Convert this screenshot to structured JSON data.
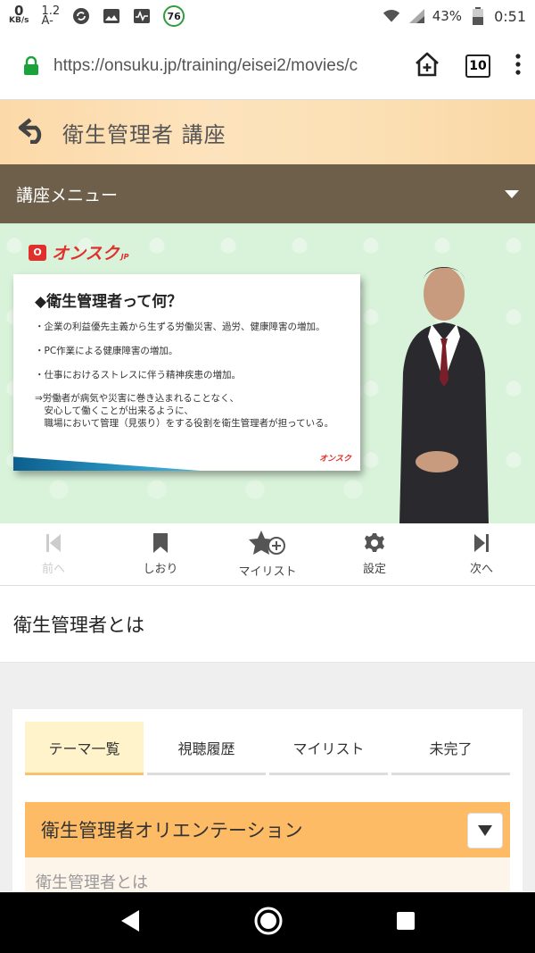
{
  "status_bar": {
    "net_speed_value": "0",
    "net_speed_unit": "KB/s",
    "text_size_top": "1.2",
    "text_size_bottom": "A-",
    "notification_badge": "76",
    "battery_percent": "43%",
    "time": "0:51"
  },
  "browser": {
    "url": "https://onsuku.jp/training/eisei2/movies/c",
    "tab_count": "10"
  },
  "course": {
    "title": "衛生管理者 講座"
  },
  "menu": {
    "label": "講座メニュー"
  },
  "video": {
    "brand": "オンスク",
    "brand_suffix": "JP",
    "slide_title": "◆衛生管理者って何？",
    "slide_lines": [
      "・企業の利益優先主義から生ずる労働災害、過労、健康障害の増加。",
      "・PC作業による健康障害の増加。",
      "・仕事におけるストレスに伴う精神疾患の増加。"
    ],
    "slide_conclusion": [
      "⇒労働者が病気や災害に巻き込まれることなく、",
      "　安心して働くことが出来るように、",
      "　職場において管理（見張り）をする役割を衛生管理者が担っている。"
    ],
    "slide_logo": "オンスク"
  },
  "controls": {
    "prev": "前へ",
    "bookmark": "しおり",
    "mylist": "マイリスト",
    "settings": "設定",
    "next": "次へ"
  },
  "lesson": {
    "title": "衛生管理者とは"
  },
  "tabs": [
    {
      "label": "テーマ一覧"
    },
    {
      "label": "視聴履歴"
    },
    {
      "label": "マイリスト"
    },
    {
      "label": "未完了"
    }
  ],
  "accordion": {
    "title": "衛生管理者オリエンテーション",
    "first_item": "衛生管理者とは"
  },
  "colors": {
    "accent_orange": "#fdbb66",
    "menu_brown": "#6e5f4a",
    "brand_red": "#e0302c",
    "badge_green": "#2e9d3c"
  }
}
